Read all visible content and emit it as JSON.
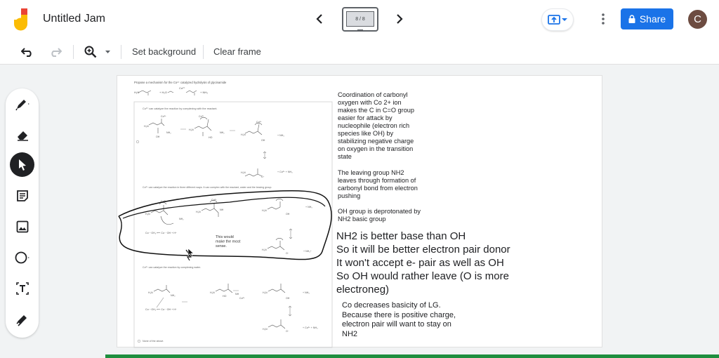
{
  "app": {
    "title": "Untitled Jam",
    "frame_counter": "8 / 8",
    "share_label": "Share",
    "avatar_initial": "C",
    "accent": "#1a73e8",
    "brand_colors": [
      "#fbbc04",
      "#ea4335"
    ]
  },
  "toolbar": {
    "set_background": "Set background",
    "clear_frame": "Clear frame"
  },
  "sidebar": {
    "tools": [
      "pen-icon",
      "eraser-icon",
      "select-icon",
      "sticky-note-icon",
      "image-icon",
      "circle-icon",
      "textbox-icon",
      "laser-icon"
    ],
    "active_tool": "select-icon"
  },
  "paper": {
    "header": "Propose a mechanism for the Co²⁺ catalyzed hydrolysis of glycinamide",
    "opt1": "Co²⁺ can catalyze the reaction by complexing with the reactant.",
    "opt2": "Co²⁺ can catalyze the reaction in three different ways. It can complex with the reactant, water and the leaving group.",
    "opt3": "Co²⁺ can catalyze the reaction by complexing water.",
    "opt4": "None of the above.",
    "annotation": "This would\nmake the most\nsense."
  },
  "notes": {
    "n1": "Coordination of carbonyl\noxygen with Co 2+ ion\nmakes the C in C=O group\neasier for attack by\nnucleophile (electron rich\nspecies like OH) by\nstabilizing negative charge\non oxygen in the transition\nstate",
    "n2": "The leaving group NH2\nleaves through formation of\ncarbonyl bond from electron\npushing",
    "n3": "OH group is deprotonated by\nNH2 basic group",
    "n4": "NH2 is better base than OH\nSo it will be better electron pair donor\nIt won't accept e- pair as well as OH\nSo OH would rather leave (O is more\nelectroneg)",
    "n5": "Co decreases basicity of LG.\nBecause there is positive charge,\nelectron pair will want to stay on\nNH2"
  }
}
